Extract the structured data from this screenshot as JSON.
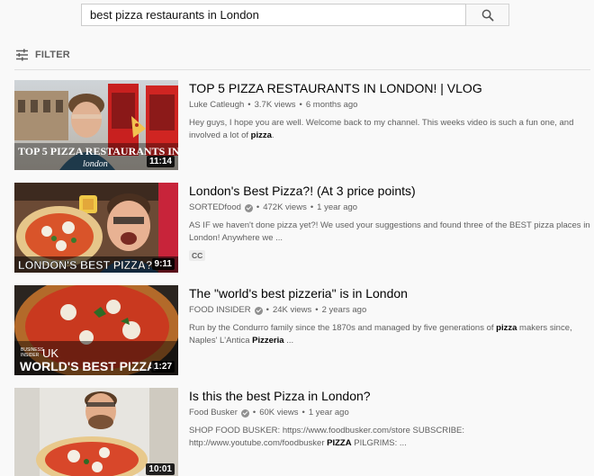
{
  "search": {
    "query": "best pizza restaurants in London"
  },
  "filter": {
    "label": "FILTER"
  },
  "results": [
    {
      "title": "TOP 5 PIZZA RESTAURANTS IN LONDON! | VLOG",
      "channel": "Luke Catleugh",
      "verified": false,
      "views": "3.7K views",
      "age": "6 months ago",
      "desc_line1_pre": "Hey guys, I hope you are well. Welcome back to my channel. This weeks video is such a fun one, and",
      "desc_line2_pre": "involved a lot of ",
      "desc_line2_bold": "pizza",
      "desc_line2_post": ".",
      "duration": "11:14",
      "thumb_text1": "TOP 5 PIZZA RESTAURANTS IN",
      "thumb_text2": "london"
    },
    {
      "title": "London's Best Pizza?! (At 3 price points)",
      "channel": "SORTEDfood",
      "verified": true,
      "views": "472K views",
      "age": "1 year ago",
      "desc_line1_pre": "AS IF we haven't done pizza yet?! We used your suggestions and found three of the BEST pizza places in",
      "desc_line2_pre": "London! Anywhere we ...",
      "badge": "CC",
      "duration": "9:11",
      "thumb_text1": "LONDON'S BEST PIZZA?"
    },
    {
      "title": "The \"world's best pizzeria\" is in London",
      "channel": "FOOD INSIDER",
      "verified": true,
      "views": "24K views",
      "age": "2 years ago",
      "desc_line1_pre": "Run by the Condurro family since the 1870s and managed by five generations of ",
      "desc_line1_bold": "pizza",
      "desc_line1_post": " makers since,",
      "desc_line2_pre": "Naples' L'Antica ",
      "desc_line2_bold": "Pizzeria",
      "desc_line2_post": " ...",
      "duration": "1:27",
      "thumb_text0a": "BUSINESS",
      "thumb_text0b": "INSIDER",
      "thumb_text0c": "UK",
      "thumb_text1": "WORLD'S BEST PIZZA"
    },
    {
      "title": "Is this the best Pizza in London?",
      "channel": "Food Busker",
      "verified": true,
      "views": "60K views",
      "age": "1 year ago",
      "desc_line1_pre": "SHOP FOOD BUSKER: https://www.foodbusker.com/store SUBSCRIBE:",
      "desc_line2_pre": "http://www.youtube.com/foodbusker ",
      "desc_line2_bold": "PIZZA",
      "desc_line2_post": " PILGRIMS: ...",
      "duration": "10:01"
    }
  ]
}
